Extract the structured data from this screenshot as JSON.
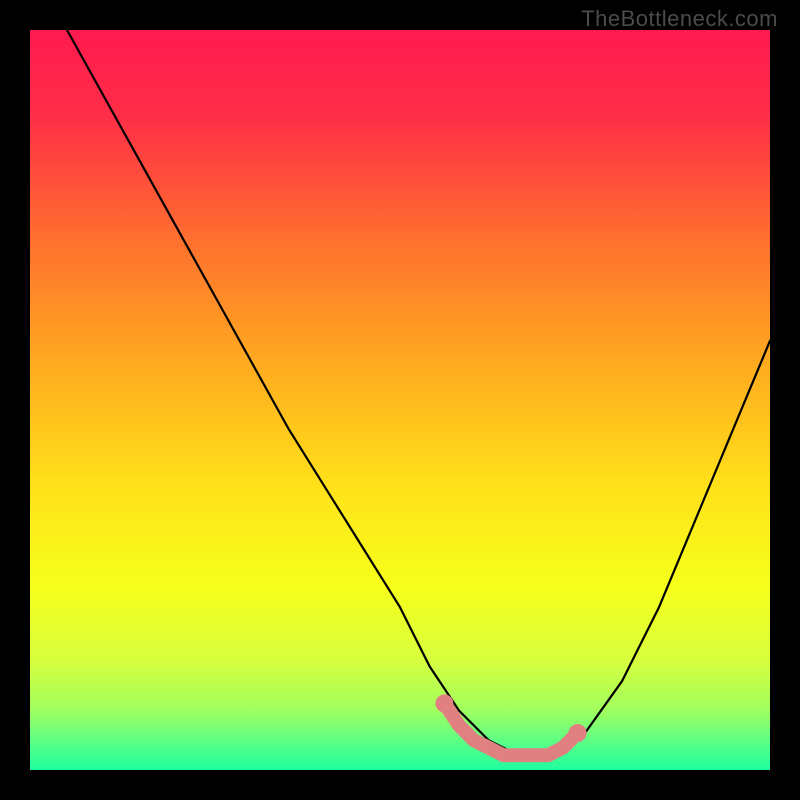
{
  "watermark": "TheBottleneck.com",
  "gradient_stops": [
    {
      "offset": 0.0,
      "color": "#ff1a4f"
    },
    {
      "offset": 0.12,
      "color": "#ff2f47"
    },
    {
      "offset": 0.28,
      "color": "#ff6e2f"
    },
    {
      "offset": 0.45,
      "color": "#ffaa1f"
    },
    {
      "offset": 0.62,
      "color": "#ffe21a"
    },
    {
      "offset": 0.75,
      "color": "#f6ff1a"
    },
    {
      "offset": 0.85,
      "color": "#d8ff3d"
    },
    {
      "offset": 0.92,
      "color": "#a0ff60"
    },
    {
      "offset": 0.97,
      "color": "#4dff8c"
    },
    {
      "offset": 1.0,
      "color": "#1fff9e"
    }
  ],
  "chart_data": {
    "type": "line",
    "title": "",
    "xlabel": "",
    "ylabel": "",
    "xlim": [
      0,
      100
    ],
    "ylim": [
      0,
      100
    ],
    "grid": false,
    "series": [
      {
        "name": "bottleneck-curve",
        "color": "#000000",
        "x": [
          5,
          10,
          15,
          20,
          25,
          30,
          35,
          40,
          45,
          50,
          54,
          58,
          62,
          66,
          70,
          75,
          80,
          85,
          90,
          95,
          100
        ],
        "values": [
          100,
          91,
          82,
          73,
          64,
          55,
          46,
          38,
          30,
          22,
          14,
          8,
          4,
          2,
          2,
          5,
          12,
          22,
          34,
          46,
          58
        ]
      }
    ],
    "markers": [
      {
        "name": "optimal-range",
        "color": "#e08080",
        "x": [
          56,
          58,
          60,
          62,
          64,
          66,
          68,
          70,
          72,
          74
        ],
        "values": [
          9,
          6,
          4,
          3,
          2,
          2,
          2,
          2,
          3,
          5
        ]
      }
    ]
  }
}
